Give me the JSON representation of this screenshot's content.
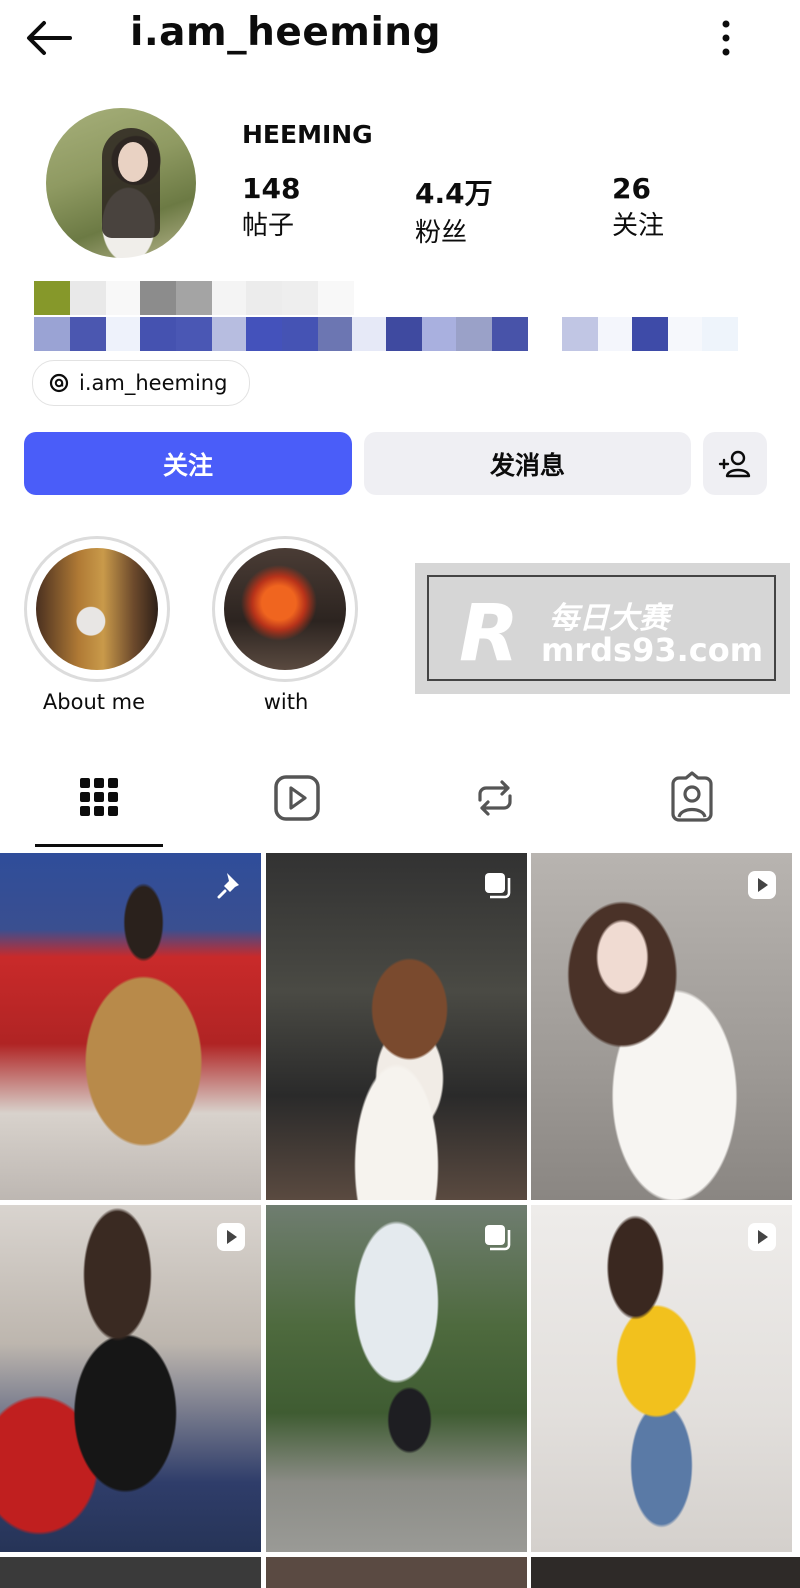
{
  "header": {
    "username": "i.am_heeming",
    "back_icon": "arrow-left-icon",
    "more_icon": "more-vertical-icon"
  },
  "profile": {
    "display_name": "HEEMING",
    "stats": [
      {
        "value": "148",
        "label": "帖子"
      },
      {
        "value": "4.4万",
        "label": "粉丝"
      },
      {
        "value": "26",
        "label": "关注"
      }
    ],
    "threads_handle": "i.am_heeming"
  },
  "actions": {
    "follow_label": "关注",
    "message_label": "发消息",
    "add_user_icon": "add-person-icon"
  },
  "highlights": [
    {
      "label": "About me"
    },
    {
      "label": "with"
    }
  ],
  "watermark": {
    "logo_letter": "R",
    "name": "每日大赛",
    "url": "mrds93.com"
  },
  "tabs": [
    {
      "icon": "grid-icon",
      "active": true
    },
    {
      "icon": "reels-icon",
      "active": false
    },
    {
      "icon": "repost-icon",
      "active": false
    },
    {
      "icon": "tagged-icon",
      "active": false
    }
  ],
  "posts": [
    {
      "badge": "pin-icon"
    },
    {
      "badge": "carousel-icon"
    },
    {
      "badge": "reel-icon"
    },
    {
      "badge": "reel-icon"
    },
    {
      "badge": "carousel-icon"
    },
    {
      "badge": "reel-icon"
    }
  ],
  "colors": {
    "accent": "#4a5df9",
    "secondary_button": "#efeff3",
    "text": "#0c0c0c"
  }
}
